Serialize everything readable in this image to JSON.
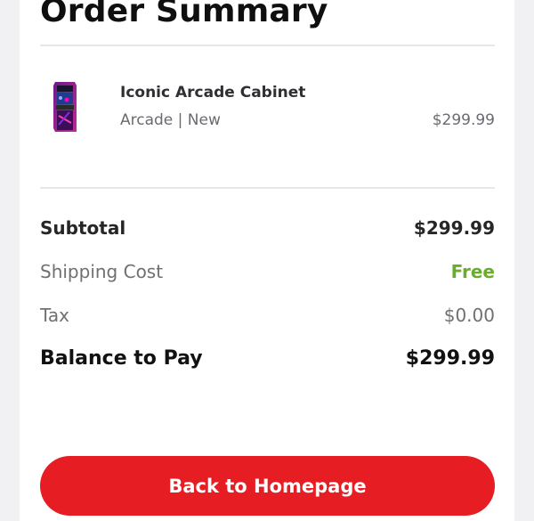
{
  "page": {
    "title": "Order Summary"
  },
  "item": {
    "name": "Iconic Arcade Cabinet",
    "meta": "Arcade | New",
    "price": "$299.99"
  },
  "totals": {
    "subtotal_label": "Subtotal",
    "subtotal_value": "$299.99",
    "shipping_label": "Shipping Cost",
    "shipping_value": "Free",
    "tax_label": "Tax",
    "tax_value": "$0.00",
    "balance_label": "Balance to Pay",
    "balance_value": "$299.99"
  },
  "cta": {
    "label": "Back to Homepage"
  },
  "colors": {
    "accent_red": "#e71d24",
    "free_green": "#6aad2b"
  },
  "icons": {
    "product_thumbnail": "arcade-cabinet-image"
  }
}
